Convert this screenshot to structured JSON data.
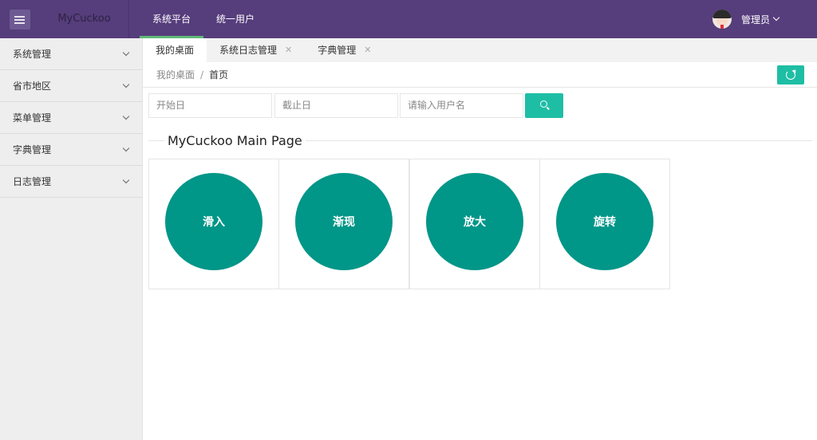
{
  "header": {
    "logo": "MyCuckoo",
    "nav": [
      "系统平台",
      "统一用户"
    ],
    "user_name": "管理员"
  },
  "sidebar": {
    "items": [
      "系统管理",
      "省市地区",
      "菜单管理",
      "字典管理",
      "日志管理"
    ]
  },
  "tabs": [
    {
      "label": "我的桌面",
      "closable": false
    },
    {
      "label": "系统日志管理",
      "closable": true
    },
    {
      "label": "字典管理",
      "closable": true
    }
  ],
  "breadcrumb": {
    "parent": "我的桌面",
    "separator": "/",
    "current": "首页"
  },
  "filters": {
    "start_placeholder": "开始日",
    "end_placeholder": "截止日",
    "user_placeholder": "请输入用户名"
  },
  "section_title": "MyCuckoo Main Page",
  "cards": [
    "滑入",
    "渐现",
    "放大",
    "旋转"
  ],
  "colors": {
    "header": "#563d7c",
    "accent": "#1ebea5",
    "circle": "#009688",
    "active_underline": "#5fb878"
  },
  "icons": {
    "menu_toggle": "menu-list-icon",
    "refresh": "refresh-icon",
    "search": "search-icon",
    "close": "close-icon"
  }
}
